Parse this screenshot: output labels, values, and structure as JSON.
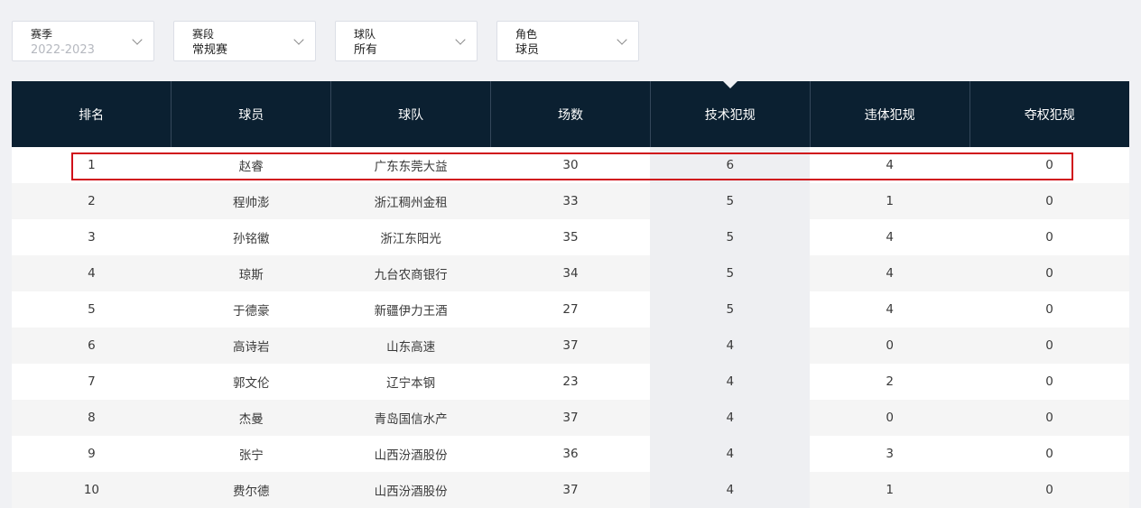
{
  "filters": [
    {
      "label": "赛季",
      "value": "2022-2023"
    },
    {
      "label": "赛段",
      "value": "常规赛"
    },
    {
      "label": "球队",
      "value": "所有"
    },
    {
      "label": "角色",
      "value": "球员"
    }
  ],
  "table": {
    "headers": [
      "排名",
      "球员",
      "球队",
      "场数",
      "技术犯规",
      "违体犯规",
      "夺权犯规"
    ],
    "sorted_column": "技术犯规",
    "rows": [
      [
        "1",
        "赵睿",
        "广东东莞大益",
        "30",
        "6",
        "4",
        "0"
      ],
      [
        "2",
        "程帅澎",
        "浙江稠州金租",
        "33",
        "5",
        "1",
        "0"
      ],
      [
        "3",
        "孙铭徽",
        "浙江东阳光",
        "35",
        "5",
        "4",
        "0"
      ],
      [
        "4",
        "琼斯",
        "九台农商银行",
        "34",
        "5",
        "4",
        "0"
      ],
      [
        "5",
        "于德豪",
        "新疆伊力王酒",
        "27",
        "5",
        "4",
        "0"
      ],
      [
        "6",
        "高诗岩",
        "山东高速",
        "37",
        "4",
        "0",
        "0"
      ],
      [
        "7",
        "郭文伦",
        "辽宁本钢",
        "23",
        "4",
        "2",
        "0"
      ],
      [
        "8",
        "杰曼",
        "青岛国信水产",
        "37",
        "4",
        "0",
        "0"
      ],
      [
        "9",
        "张宁",
        "山西汾酒股份",
        "36",
        "4",
        "3",
        "0"
      ],
      [
        "10",
        "费尔德",
        "山西汾酒股份",
        "37",
        "4",
        "1",
        "0"
      ]
    ]
  },
  "colors": {
    "header_bg": "#0b2031",
    "highlight_border": "#d0101a",
    "sorted_column_bg": "#eeeff2"
  }
}
